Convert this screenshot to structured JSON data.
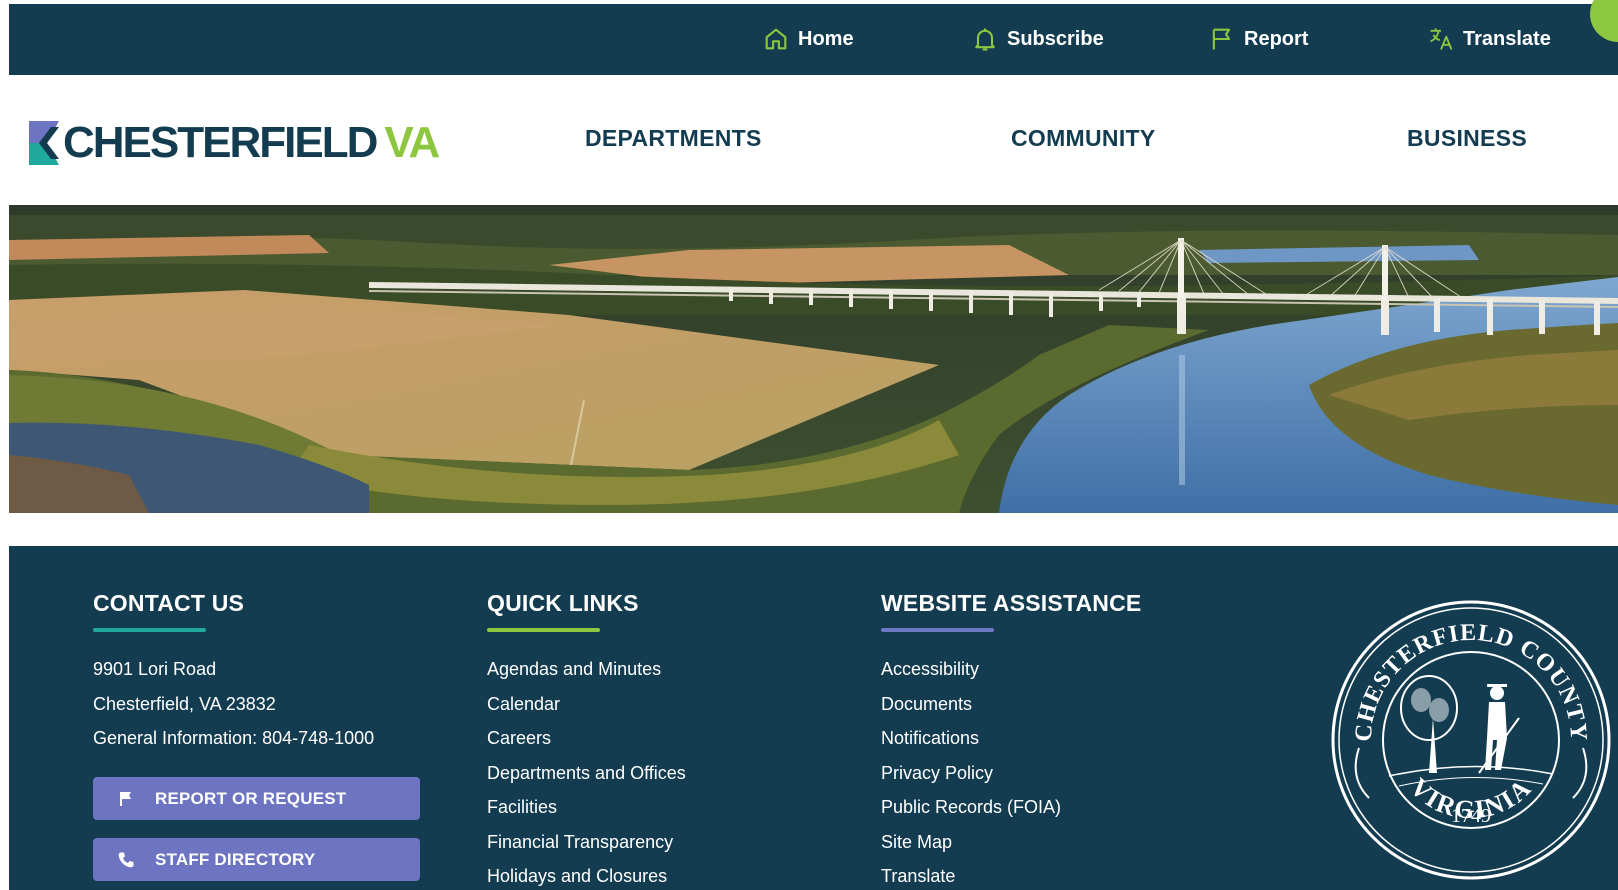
{
  "utility_bar": {
    "items": [
      {
        "label": "Home",
        "icon": "home-icon"
      },
      {
        "label": "Subscribe",
        "icon": "bell-icon"
      },
      {
        "label": "Report",
        "icon": "flag-icon"
      },
      {
        "label": "Translate",
        "icon": "translate-icon"
      }
    ]
  },
  "brand": {
    "name": "CHESTERFIELD",
    "suffix": "VA",
    "colors": {
      "navy": "#133c50",
      "green": "#8dc63f",
      "teal": "#1fa89c",
      "purple": "#6d74c2"
    }
  },
  "main_nav": {
    "items": [
      "DEPARTMENTS",
      "COMMUNITY",
      "BUSINESS"
    ]
  },
  "hero": {
    "description_icon": "aerial-landscape-image"
  },
  "footer": {
    "contact": {
      "heading": "CONTACT US",
      "lines": [
        "9901 Lori Road",
        "Chesterfield, VA 23832",
        "General Information: 804-748-1000"
      ],
      "buttons": [
        {
          "label": "REPORT OR REQUEST",
          "icon": "flag-icon"
        },
        {
          "label": "STAFF DIRECTORY",
          "icon": "phone-icon"
        }
      ]
    },
    "quick_links": {
      "heading": "QUICK LINKS",
      "links": [
        "Agendas and Minutes",
        "Calendar",
        "Careers",
        "Departments and Offices",
        "Facilities",
        "Financial Transparency",
        "Holidays and Closures"
      ]
    },
    "website_assistance": {
      "heading": "WEBSITE ASSISTANCE",
      "links": [
        "Accessibility",
        "Documents",
        "Notifications",
        "Privacy Policy",
        "Public Records (FOIA)",
        "Site Map",
        "Translate"
      ]
    },
    "seal": {
      "top_text": "CHESTERFIELD COUNTY",
      "year": "1749",
      "bottom_text": "VIRGINIA"
    }
  }
}
